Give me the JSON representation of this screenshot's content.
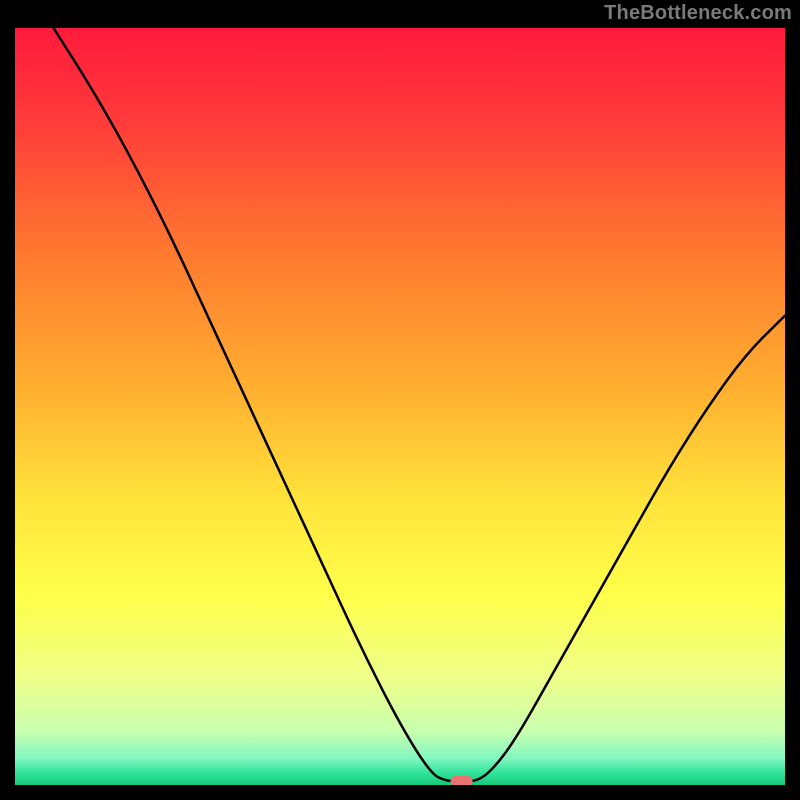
{
  "watermark": "TheBottleneck.com",
  "chart_data": {
    "type": "line",
    "title": "",
    "xlabel": "",
    "ylabel": "",
    "xlim": [
      0,
      100
    ],
    "ylim": [
      0,
      100
    ],
    "curve": {
      "name": "bottleneck-curve",
      "points": [
        {
          "x": 5,
          "y": 100
        },
        {
          "x": 10,
          "y": 92
        },
        {
          "x": 15,
          "y": 83
        },
        {
          "x": 20,
          "y": 73
        },
        {
          "x": 25,
          "y": 62
        },
        {
          "x": 30,
          "y": 51
        },
        {
          "x": 35,
          "y": 40
        },
        {
          "x": 40,
          "y": 29
        },
        {
          "x": 45,
          "y": 18
        },
        {
          "x": 50,
          "y": 8
        },
        {
          "x": 54,
          "y": 1.5
        },
        {
          "x": 56,
          "y": 0.5
        },
        {
          "x": 58,
          "y": 0.5
        },
        {
          "x": 60,
          "y": 0.5
        },
        {
          "x": 62,
          "y": 2
        },
        {
          "x": 65,
          "y": 6
        },
        {
          "x": 70,
          "y": 15
        },
        {
          "x": 75,
          "y": 24
        },
        {
          "x": 80,
          "y": 33
        },
        {
          "x": 85,
          "y": 42
        },
        {
          "x": 90,
          "y": 50
        },
        {
          "x": 95,
          "y": 57
        },
        {
          "x": 100,
          "y": 62
        }
      ]
    },
    "marker": {
      "x": 58,
      "y": 0.5,
      "color": "#e97272"
    },
    "gradient_stops": [
      {
        "offset": 0,
        "color": "#ff1a3c"
      },
      {
        "offset": 0.12,
        "color": "#ff3a3a"
      },
      {
        "offset": 0.3,
        "color": "#ff7a2f"
      },
      {
        "offset": 0.48,
        "color": "#ffb030"
      },
      {
        "offset": 0.62,
        "color": "#ffe23a"
      },
      {
        "offset": 0.75,
        "color": "#ffff4a"
      },
      {
        "offset": 0.86,
        "color": "#eeff8a"
      },
      {
        "offset": 0.93,
        "color": "#c8ffb0"
      },
      {
        "offset": 0.965,
        "color": "#80f7c0"
      },
      {
        "offset": 0.985,
        "color": "#2de29a"
      },
      {
        "offset": 1.0,
        "color": "#17c877"
      }
    ],
    "curve_color": "#000000",
    "curve_width": 2.5
  }
}
